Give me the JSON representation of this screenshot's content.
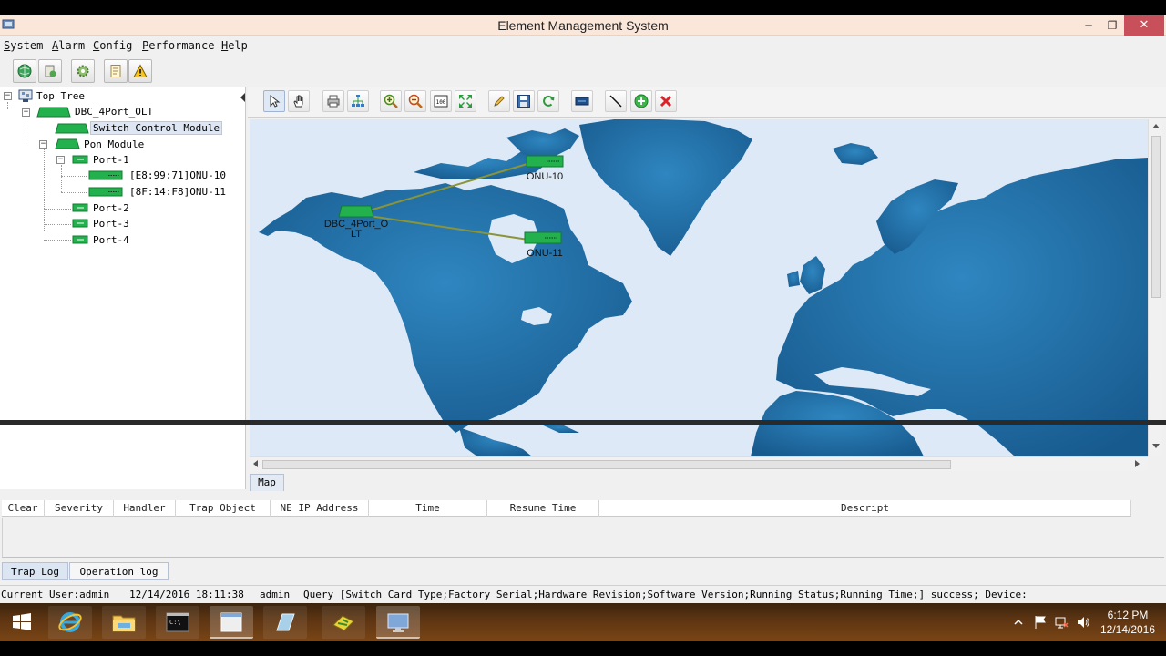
{
  "window": {
    "title": "Element Management System",
    "minimize": "─",
    "restore": "❐",
    "close": "✕"
  },
  "menu": {
    "items": [
      {
        "first": "S",
        "rest": "ystem"
      },
      {
        "first": "A",
        "rest": "larm"
      },
      {
        "first": "C",
        "rest": "onfig"
      },
      {
        "first": "P",
        "rest": "erformance"
      },
      {
        "first": "H",
        "rest": "elp"
      }
    ]
  },
  "toolbar": {
    "icons": [
      "globe-icon",
      "database-icon",
      "settings-icon",
      "report-icon",
      "alarm-warning-icon"
    ]
  },
  "tree": {
    "root": "Top Tree",
    "olt": "DBC_4Port_OLT",
    "switch_module": "Switch Control Module",
    "pon_module": "Pon Module",
    "port1": "Port-1",
    "onu1": "[E8:99:71]ONU-10",
    "onu2": "[8F:14:F8]ONU-11",
    "port2": "Port-2",
    "port3": "Port-3",
    "port4": "Port-4"
  },
  "map": {
    "tab": "Map",
    "nodes": {
      "olt_label_1": "DBC_4Port_O",
      "olt_label_2": "LT",
      "onu10_label": "ONU-10",
      "onu11_label": "ONU-11"
    },
    "colors": {
      "ocean": "#dde9f6",
      "land": "#1f6aa0",
      "device": "#22b14c",
      "link": "#8a9438"
    }
  },
  "trap": {
    "columns": [
      "Clear",
      "Severity",
      "Handler",
      "Trap Object",
      "NE IP Address",
      "Time",
      "Resume Time",
      "Descript"
    ],
    "tabs": [
      "Trap Log",
      "Operation log"
    ]
  },
  "status": {
    "user": "Current User:admin",
    "timestamp": "12/14/2016 18:11:38",
    "operator": "admin",
    "message": "Query [Switch Card Type;Factory Serial;Hardware Revision;Software Version;Running Status;Running Time;] success; Device:"
  },
  "taskbar": {
    "clock_time": "6:12 PM",
    "clock_date": "12/14/2016"
  }
}
